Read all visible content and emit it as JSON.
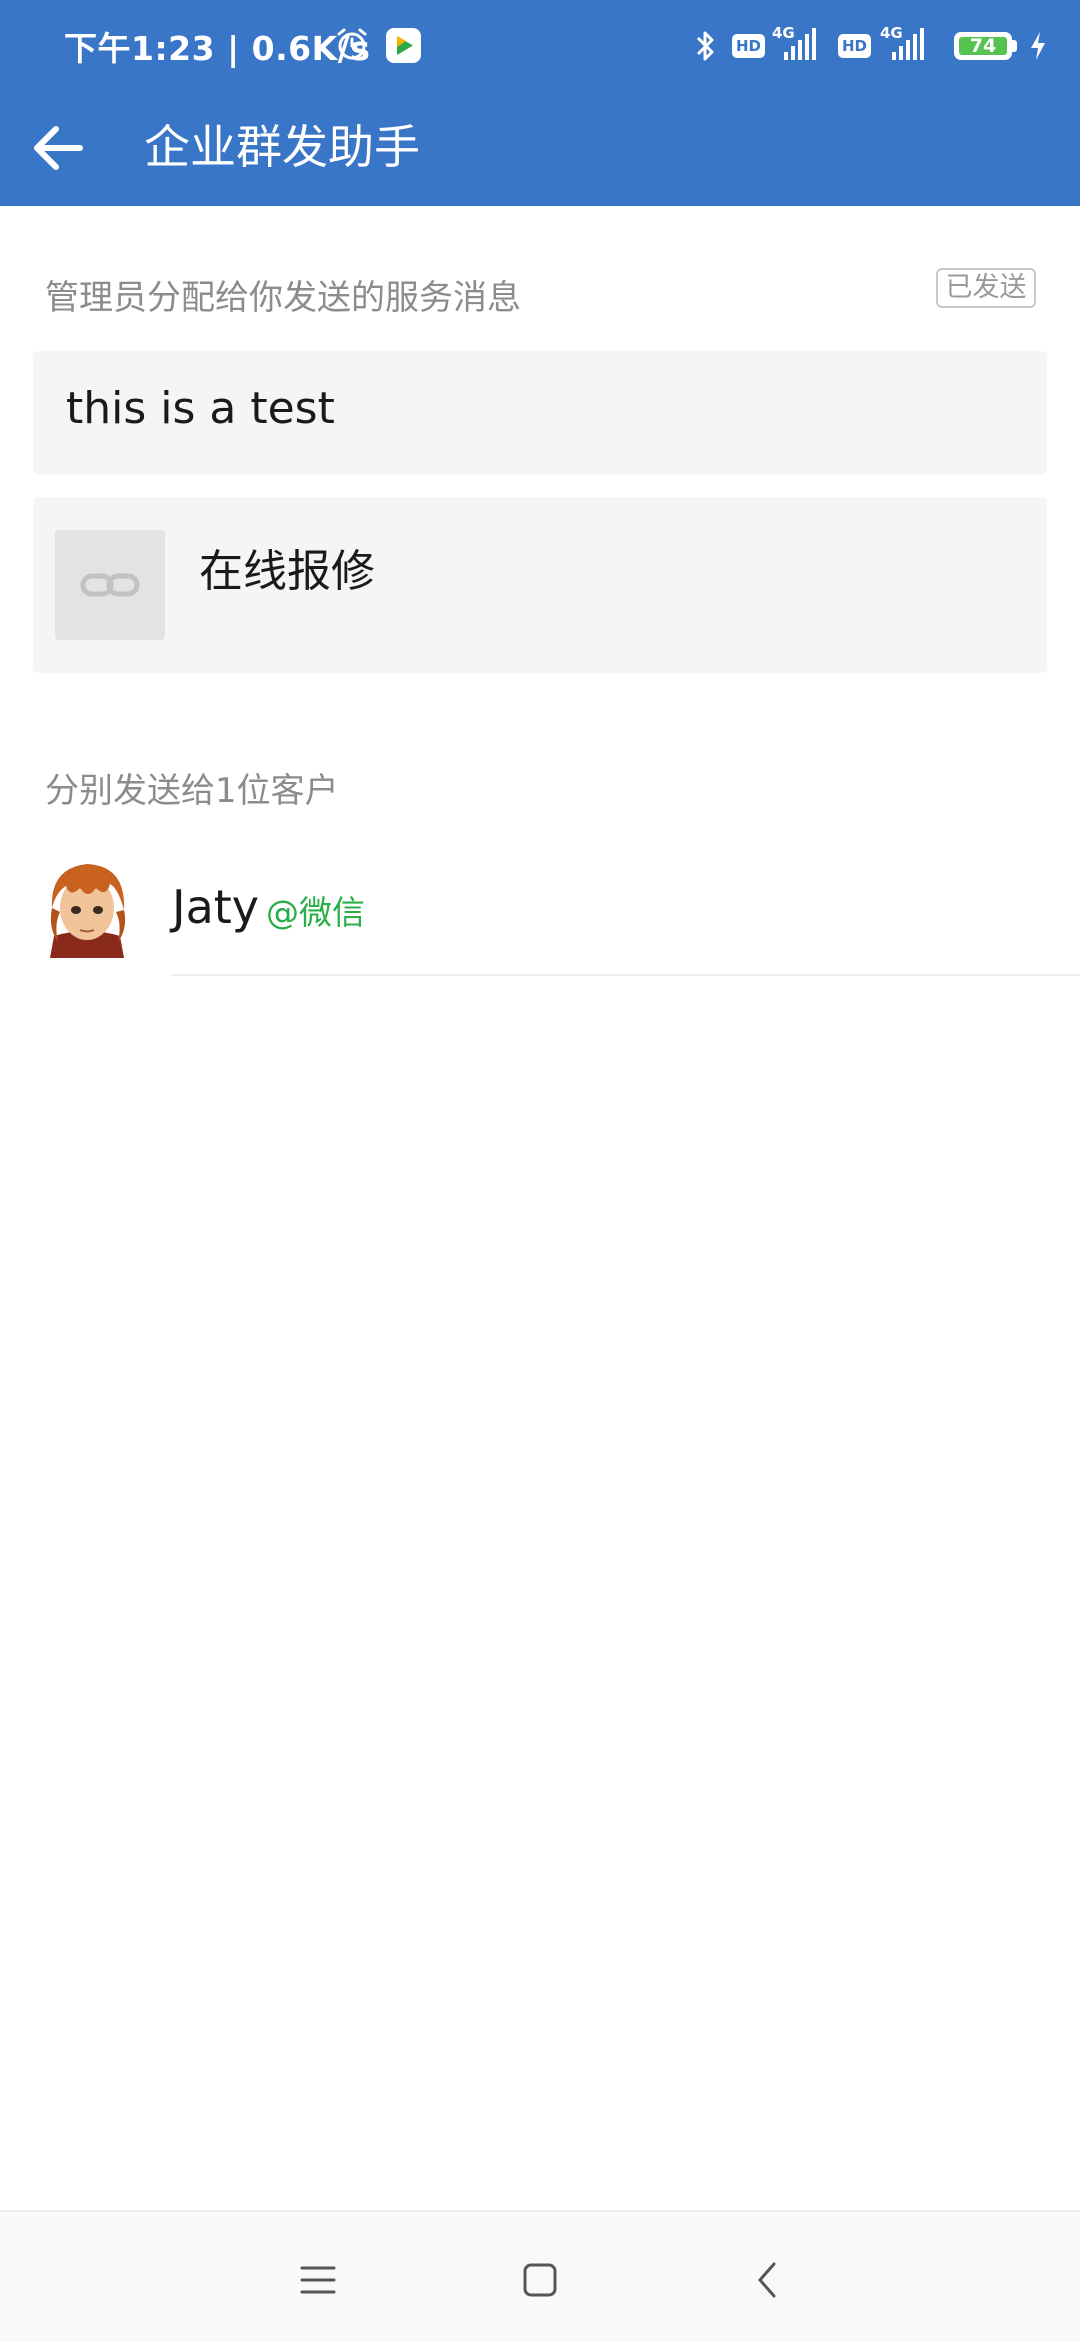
{
  "status_bar": {
    "time": "下午1:23 | 0.6K/s",
    "hd1": "HD",
    "net1": "4G",
    "hd2": "HD",
    "net2": "4G",
    "battery": "74"
  },
  "header": {
    "title": "企业群发助手",
    "background_color": "#3a76c8"
  },
  "message_section": {
    "label": "管理员分配给你发送的服务消息",
    "status_badge": "已发送",
    "text_message": "this is a test",
    "link_card": {
      "title": "在线报修",
      "thumbnail_icon": "link-icon"
    }
  },
  "recipients_section": {
    "label": "分别发送给1位客户",
    "customers": [
      {
        "name": "Jaty",
        "source": "@微信",
        "source_color": "#2aae4a"
      }
    ]
  },
  "bottom_nav": {
    "items": [
      "menu-icon",
      "home-icon",
      "back-icon"
    ]
  }
}
